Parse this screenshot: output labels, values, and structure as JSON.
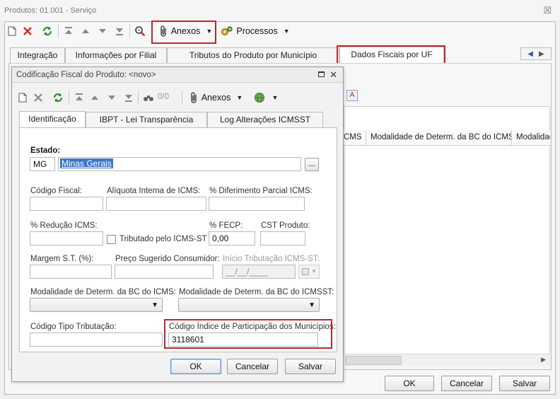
{
  "window": {
    "title": "Produtos: 01.001 - Serviço",
    "close_glyph": "☒"
  },
  "main_toolbar": {
    "attachments_label": "Anexos",
    "processes_label": "Processos"
  },
  "main_tabs": [
    {
      "label": "Integração"
    },
    {
      "label": "Informações por Filial"
    },
    {
      "label": "Tributos do Produto por Município"
    },
    {
      "label": "Dados Fiscais por UF",
      "selected": true
    }
  ],
  "background_grid": {
    "columns": [
      "CMS",
      "Modalidade de Determ. da BC do ICMS",
      "Modalidac"
    ]
  },
  "main_buttons": {
    "ok": "OK",
    "cancel": "Cancelar",
    "save": "Salvar"
  },
  "dialog": {
    "title": "Codificação Fiscal do Produto: <novo>",
    "toolbar": {
      "counter": "0/0",
      "attachments_label": "Anexos"
    },
    "tabs": [
      {
        "label": "Identificação",
        "selected": true
      },
      {
        "label": "IBPT - Lei Transparência"
      },
      {
        "label": "Log Alterações ICMSST"
      }
    ],
    "form": {
      "estado_label": "Estado:",
      "estado_code": "MG",
      "estado_name": "Minas Gerais",
      "lookup_button": "...",
      "codigo_fiscal_label": "Código Fiscal:",
      "codigo_fiscal_value": "",
      "aliquota_interna_label": "Alíquota Interna de ICMS:",
      "aliquota_interna_value": "",
      "diferimento_label": "% Diferimento Parcial ICMS:",
      "diferimento_value": "",
      "reducao_label": "% Redução ICMS:",
      "reducao_value": "",
      "tributado_st_label": "Tributado pelo ICMS-ST",
      "tributado_st_checked": false,
      "fecp_label": "% FECP:",
      "fecp_value": "0,00",
      "cst_label": "CST Produto:",
      "cst_value": "",
      "margem_st_label": "Margem S.T. (%):",
      "margem_st_value": "",
      "preco_sugerido_label": "Preço Sugerido Consumidor:",
      "preco_sugerido_value": "",
      "inicio_tributacao_label": "Início Tributação ICMS-ST:",
      "inicio_tributacao_value": "__/__/____",
      "modalidade_icms_label": "Modalidade de Determ. da BC do ICMS:",
      "modalidade_icms_value": "",
      "modalidade_icmsst_label": "Modalidade de Determ. da BC do ICMSST:",
      "modalidade_icmsst_value": "",
      "codigo_tipo_trib_label": "Código Tipo Tributação:",
      "codigo_tipo_trib_value": "",
      "codigo_indice_label": "Código Índice de Participação dos Municípios:",
      "codigo_indice_value": "3118601"
    },
    "buttons": {
      "ok": "OK",
      "cancel": "Cancelar",
      "save": "Salvar"
    }
  },
  "colors": {
    "highlight_box": "#c0262d",
    "selection": "#3a78c8",
    "delete_icon": "#d9262c",
    "refresh_icon": "#2e8b2e"
  }
}
